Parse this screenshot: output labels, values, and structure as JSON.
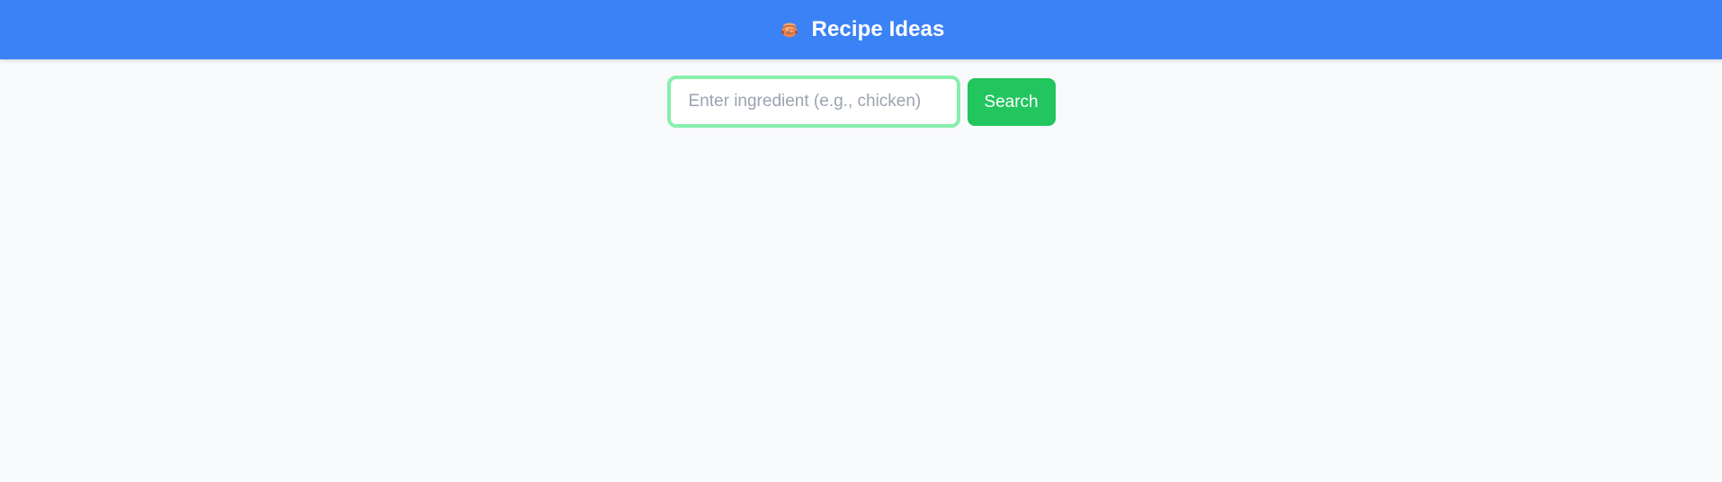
{
  "header": {
    "icon": "cooking-pot-icon",
    "title": "Recipe Ideas"
  },
  "search": {
    "value": "",
    "placeholder": "Enter ingredient (e.g., chicken)",
    "button_label": "Search"
  },
  "colors": {
    "header_background": "#3b82f6",
    "page_background": "#f8fafc",
    "input_border": "#86efac",
    "button_background": "#22c55e"
  }
}
